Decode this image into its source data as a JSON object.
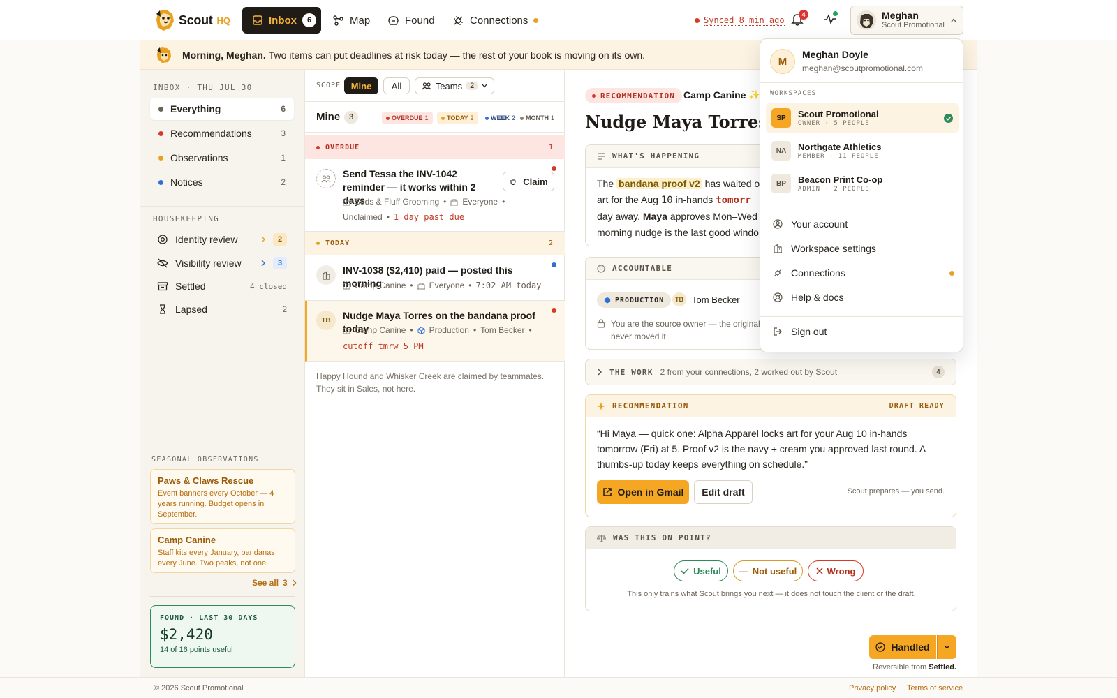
{
  "brand": {
    "name": "Scout",
    "suffix": "HQ"
  },
  "nav": {
    "inbox_label": "Inbox",
    "inbox_count": "6",
    "map_label": "Map",
    "found_label": "Found",
    "connections_label": "Connections",
    "sync_text": "Synced 8 min ago",
    "notif_count": "4",
    "user_name": "Meghan",
    "user_org": "Scout Promotional"
  },
  "greeting": {
    "bold": "Morning, Meghan.",
    "rest": "Two items can put deadlines at risk today — the rest of your book is moving on its own."
  },
  "sidebar": {
    "inbox_label": "INBOX · THU JUL 30",
    "items": [
      {
        "label": "Everything",
        "count": "6"
      },
      {
        "label": "Recommendations",
        "count": "3"
      },
      {
        "label": "Observations",
        "count": "1"
      },
      {
        "label": "Notices",
        "count": "2"
      }
    ],
    "housekeeping_label": "HOUSEKEEPING",
    "hk": [
      {
        "label": "Identity review",
        "count": "2"
      },
      {
        "label": "Visibility review",
        "count": "3"
      },
      {
        "label": "Settled",
        "count": "4 closed"
      },
      {
        "label": "Lapsed",
        "count": "2"
      }
    ],
    "seasonal_label": "SEASONAL OBSERVATIONS",
    "seasonal": [
      {
        "title": "Paws & Claws Rescue",
        "desc": "Event banners every October — 4 years running. Budget opens in September."
      },
      {
        "title": "Camp Canine",
        "desc": "Staff kits every January, bandanas every June. Two peaks, not one."
      }
    ],
    "see_all": "See all",
    "see_all_count": "3",
    "found_label": "FOUND · LAST 30 DAYS",
    "found_amount": "$2,420",
    "found_sub": "14 of 16 points useful"
  },
  "list": {
    "scope_label": "SCOPE",
    "mine": "Mine",
    "all": "All",
    "teams": "Teams",
    "teams_count": "2",
    "heading": "Mine",
    "heading_count": "3",
    "tags": [
      {
        "label": "OVERDUE",
        "count": "1"
      },
      {
        "label": "TODAY",
        "count": "2"
      },
      {
        "label": "WEEK",
        "count": "2"
      },
      {
        "label": "MONTH",
        "count": "1"
      }
    ],
    "overdue_label": "OVERDUE",
    "overdue_count": "1",
    "today_label": "TODAY",
    "today_count": "2",
    "cards": [
      {
        "title": "Send Tessa the INV-1042 reminder — it works within 2 days",
        "client": "Suds & Fluff Grooming",
        "team": "Everyone",
        "status": "Unclaimed",
        "due": "1 day past due",
        "claim": "Claim"
      },
      {
        "title": "INV-1038 ($2,410) paid — posted this morning",
        "client": "Camp Canine",
        "team": "Everyone",
        "time": "7:02 AM today"
      },
      {
        "title": "Nudge Maya Torres on the bandana proof today",
        "initials": "TB",
        "client": "Camp Canine",
        "team": "Production",
        "owner": "Tom Becker",
        "cutoff": "cutoff tmrw 5 PM"
      }
    ],
    "footnote": "Happy Hound and Whisker Creek are claimed by teammates. They sit in Sales, not here."
  },
  "detail": {
    "kind": "RECOMMENDATION",
    "client": "Camp Canine",
    "title": "Nudge Maya Torres on",
    "whats_label": "WHAT'S HAPPENING",
    "w1a": "The",
    "w1b": "bandana proof v2",
    "w1c": "has waited o",
    "w2a": "art for the Aug",
    "w2b": "10",
    "w2c": "in-hands",
    "w2d": "tomorr",
    "w3a": "day away.",
    "w3b": "Maya",
    "w3c": "approves Mon–Wed",
    "w4": "morning nudge is the last good windo",
    "accountable_label": "ACCOUNTABLE",
    "team_tag": "PRODUCTION",
    "owner_initials": "TB",
    "owner": "Tom Becker",
    "acc_note1": "You are the source owner — the original",
    "acc_note2": "never moved it.",
    "work_label": "THE WORK",
    "work_desc": "2 from your connections, 2 worked out by Scout",
    "work_count": "4",
    "rec_label": "RECOMMENDATION",
    "rec_status": "DRAFT READY",
    "rec_text": "“Hi Maya — quick one: Alpha Apparel locks art for your Aug 10 in-hands tomorrow (Fri) at 5. Proof v2 is the navy + cream you approved last round. A thumbs-up today keeps everything on schedule.”",
    "open_gmail": "Open in Gmail",
    "edit_draft": "Edit draft",
    "prep_note": "Scout prepares — you send.",
    "fb_label": "WAS THIS ON POINT?",
    "useful": "Useful",
    "not_useful": "Not useful",
    "wrong": "Wrong",
    "fb_note": "This only trains what Scout brings you next — it does not touch the client or the draft.",
    "handled": "Handled",
    "reversible_a": "Reversible from",
    "reversible_b": "Settled."
  },
  "menu": {
    "name": "Meghan Doyle",
    "email": "meghan@scoutpromotional.com",
    "initial": "M",
    "workspaces_label": "WORKSPACES",
    "workspaces": [
      {
        "initials": "SP",
        "name": "Scout Promotional",
        "role": "OWNER · 5 PEOPLE"
      },
      {
        "initials": "NA",
        "name": "Northgate Athletics",
        "role": "MEMBER · 11 PEOPLE"
      },
      {
        "initials": "BP",
        "name": "Beacon Print Co-op",
        "role": "ADMIN · 2 PEOPLE"
      }
    ],
    "account": "Your account",
    "settings": "Workspace settings",
    "connections": "Connections",
    "help": "Help & docs",
    "signout": "Sign out"
  },
  "footer": {
    "copy": "© 2026 Scout Promotional",
    "privacy": "Privacy policy",
    "terms": "Terms of service"
  },
  "colors": {
    "accent": "#f5a623",
    "dark": "#1f1b16",
    "red": "#d63a26",
    "amber": "#e8a020",
    "blue": "#2f6fd6",
    "green": "#2f8a5b"
  }
}
